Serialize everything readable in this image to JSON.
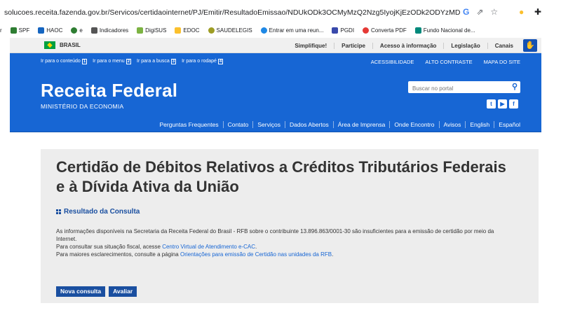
{
  "browser": {
    "url": "solucoes.receita.fazenda.gov.br/Servicos/certidaointernet/PJ/Emitir/ResultadoEmissao/NDUkODk3OCMyMzQ2Nzg5IyojKjEzODk2ODYzMDAwMTM...",
    "bookmarks": [
      {
        "label": "r",
        "color": "#ffffff"
      },
      {
        "label": "SPF",
        "color": "#2e7d32"
      },
      {
        "label": "HAOC",
        "color": "#1565c0"
      },
      {
        "label": "e",
        "color": "#2e7d32"
      },
      {
        "label": "Indicadores",
        "color": "#555555"
      },
      {
        "label": "DigiSUS",
        "color": "#7cb342"
      },
      {
        "label": "EDOC",
        "color": "#fbc02d"
      },
      {
        "label": "SAUDELEGIS",
        "color": "#9e9d24"
      },
      {
        "label": "Entrar em uma reun...",
        "color": "#1e88e5"
      },
      {
        "label": "PGDI",
        "color": "#3949ab"
      },
      {
        "label": "Converta PDF",
        "color": "#e53935"
      },
      {
        "label": "Fundo Nacional de...",
        "color": "#00897b"
      }
    ]
  },
  "govbar": {
    "country": "BRASIL",
    "links": [
      "Simplifique!",
      "Participe",
      "Acesso à informação",
      "Legislação",
      "Canais"
    ]
  },
  "header": {
    "skip_links": [
      {
        "label": "Ir para o conteúdo",
        "key": "1"
      },
      {
        "label": "Ir para o menu",
        "key": "2"
      },
      {
        "label": "Ir para a busca",
        "key": "3"
      },
      {
        "label": "Ir para o rodapé",
        "key": "4"
      }
    ],
    "access_links": [
      "ACESSIBILIDADE",
      "ALTO CONTRASTE",
      "MAPA DO SITE"
    ],
    "title": "Receita Federal",
    "subtitle": "MINISTÉRIO DA ECONOMIA",
    "search_placeholder": "Buscar no portal",
    "nav": [
      "Perguntas Frequentes",
      "Contato",
      "Serviços",
      "Dados Abertos",
      "Área de Imprensa",
      "Onde Encontro",
      "Avisos",
      "English",
      "Español"
    ]
  },
  "content": {
    "title": "Certidão de Débitos Relativos a Créditos Tributários Federais e à Dívida Ativa da União",
    "section": "Resultado da Consulta",
    "para1": "As informações disponíveis na Secretaria da Receita Federal do Brasil - RFB sobre o contribuinte 13.896.863/0001-30 são insuficientes para a emissão de certidão por meio da Internet.",
    "para2_text": "Para consultar sua situação fiscal, acesse ",
    "para2_link": "Centro Virtual de Atendimento e-CAC",
    "para3_text": "Para maiores esclarecimentos, consulte a página ",
    "para3_link": "Orientações para emissão de Certidão nas unidades da RFB",
    "btn_new": "Nova consulta",
    "btn_rate": "Avaliar"
  }
}
